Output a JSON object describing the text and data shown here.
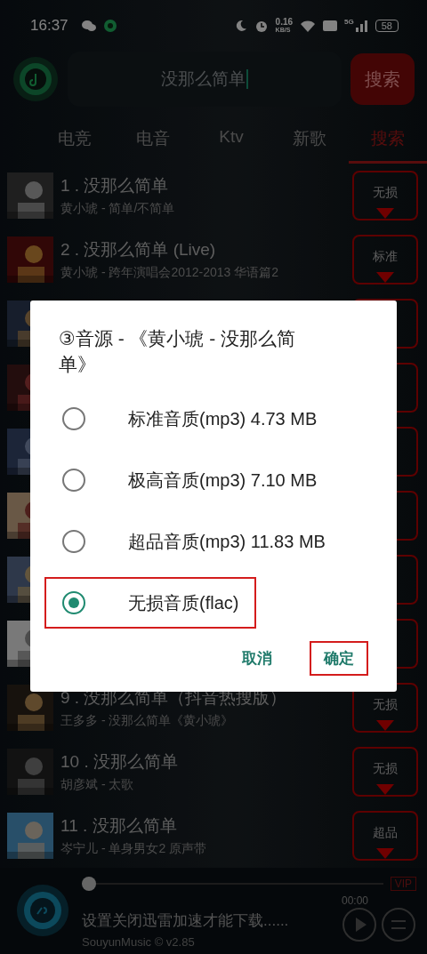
{
  "status_bar": {
    "time": "16:37",
    "speed": "0.16",
    "speed_unit": "KB/S",
    "network": "5G",
    "battery": "58"
  },
  "search": {
    "value": "没那么简单",
    "button": "搜索"
  },
  "tabs": [
    {
      "label": "电竞",
      "selected": false
    },
    {
      "label": "电音",
      "selected": false
    },
    {
      "label": "Ktv",
      "selected": false
    },
    {
      "label": "新歌",
      "selected": false
    },
    {
      "label": "搜索",
      "selected": true
    }
  ],
  "songs": [
    {
      "kind": "song",
      "title": "1 . 没那么简单",
      "subtitle": "黄小琥 - 简单/不简单",
      "quality": "无损"
    },
    {
      "kind": "song",
      "title": "2 . 没那么简单 (Live)",
      "subtitle": "黄小琥 - 跨年演唱会2012-2013 华语篇2",
      "quality": "标准"
    },
    {
      "kind": "covered"
    },
    {
      "kind": "covered"
    },
    {
      "kind": "covered"
    },
    {
      "kind": "covered"
    },
    {
      "kind": "covered"
    },
    {
      "kind": "covered"
    },
    {
      "kind": "song",
      "title": "9 . 没那么简单（抖音热搜版）",
      "subtitle": "王多多 - 没那么简单《黄小琥》",
      "quality": "无损"
    },
    {
      "kind": "song",
      "title": "10 . 没那么简单",
      "subtitle": "胡彦斌 - 太歌",
      "quality": "无损"
    },
    {
      "kind": "song",
      "title": "11 . 没那么简单",
      "subtitle": "岑宁儿 - 单身男女2 原声带",
      "quality": "超品"
    }
  ],
  "dialog": {
    "title": "③音源 - 《黄小琥 - 没那么简单》",
    "options": [
      {
        "label": "标准音质(mp3) 4.73 MB",
        "selected": false,
        "highlighted": false
      },
      {
        "label": "极高音质(mp3) 7.10 MB",
        "selected": false,
        "highlighted": false
      },
      {
        "label": "超品音质(mp3) 11.83 MB",
        "selected": false,
        "highlighted": false
      },
      {
        "label": "无损音质(flac)",
        "selected": true,
        "highlighted": true
      }
    ],
    "buttons": [
      {
        "label": "取消",
        "highlighted": false
      },
      {
        "label": "确定",
        "highlighted": true
      }
    ]
  },
  "player": {
    "progress": {
      "level": 0
    },
    "vip": "VIP",
    "time": "00:00",
    "message": "设置关闭迅雷加速才能下载......",
    "version": "SouyunMusic © v2.85"
  }
}
